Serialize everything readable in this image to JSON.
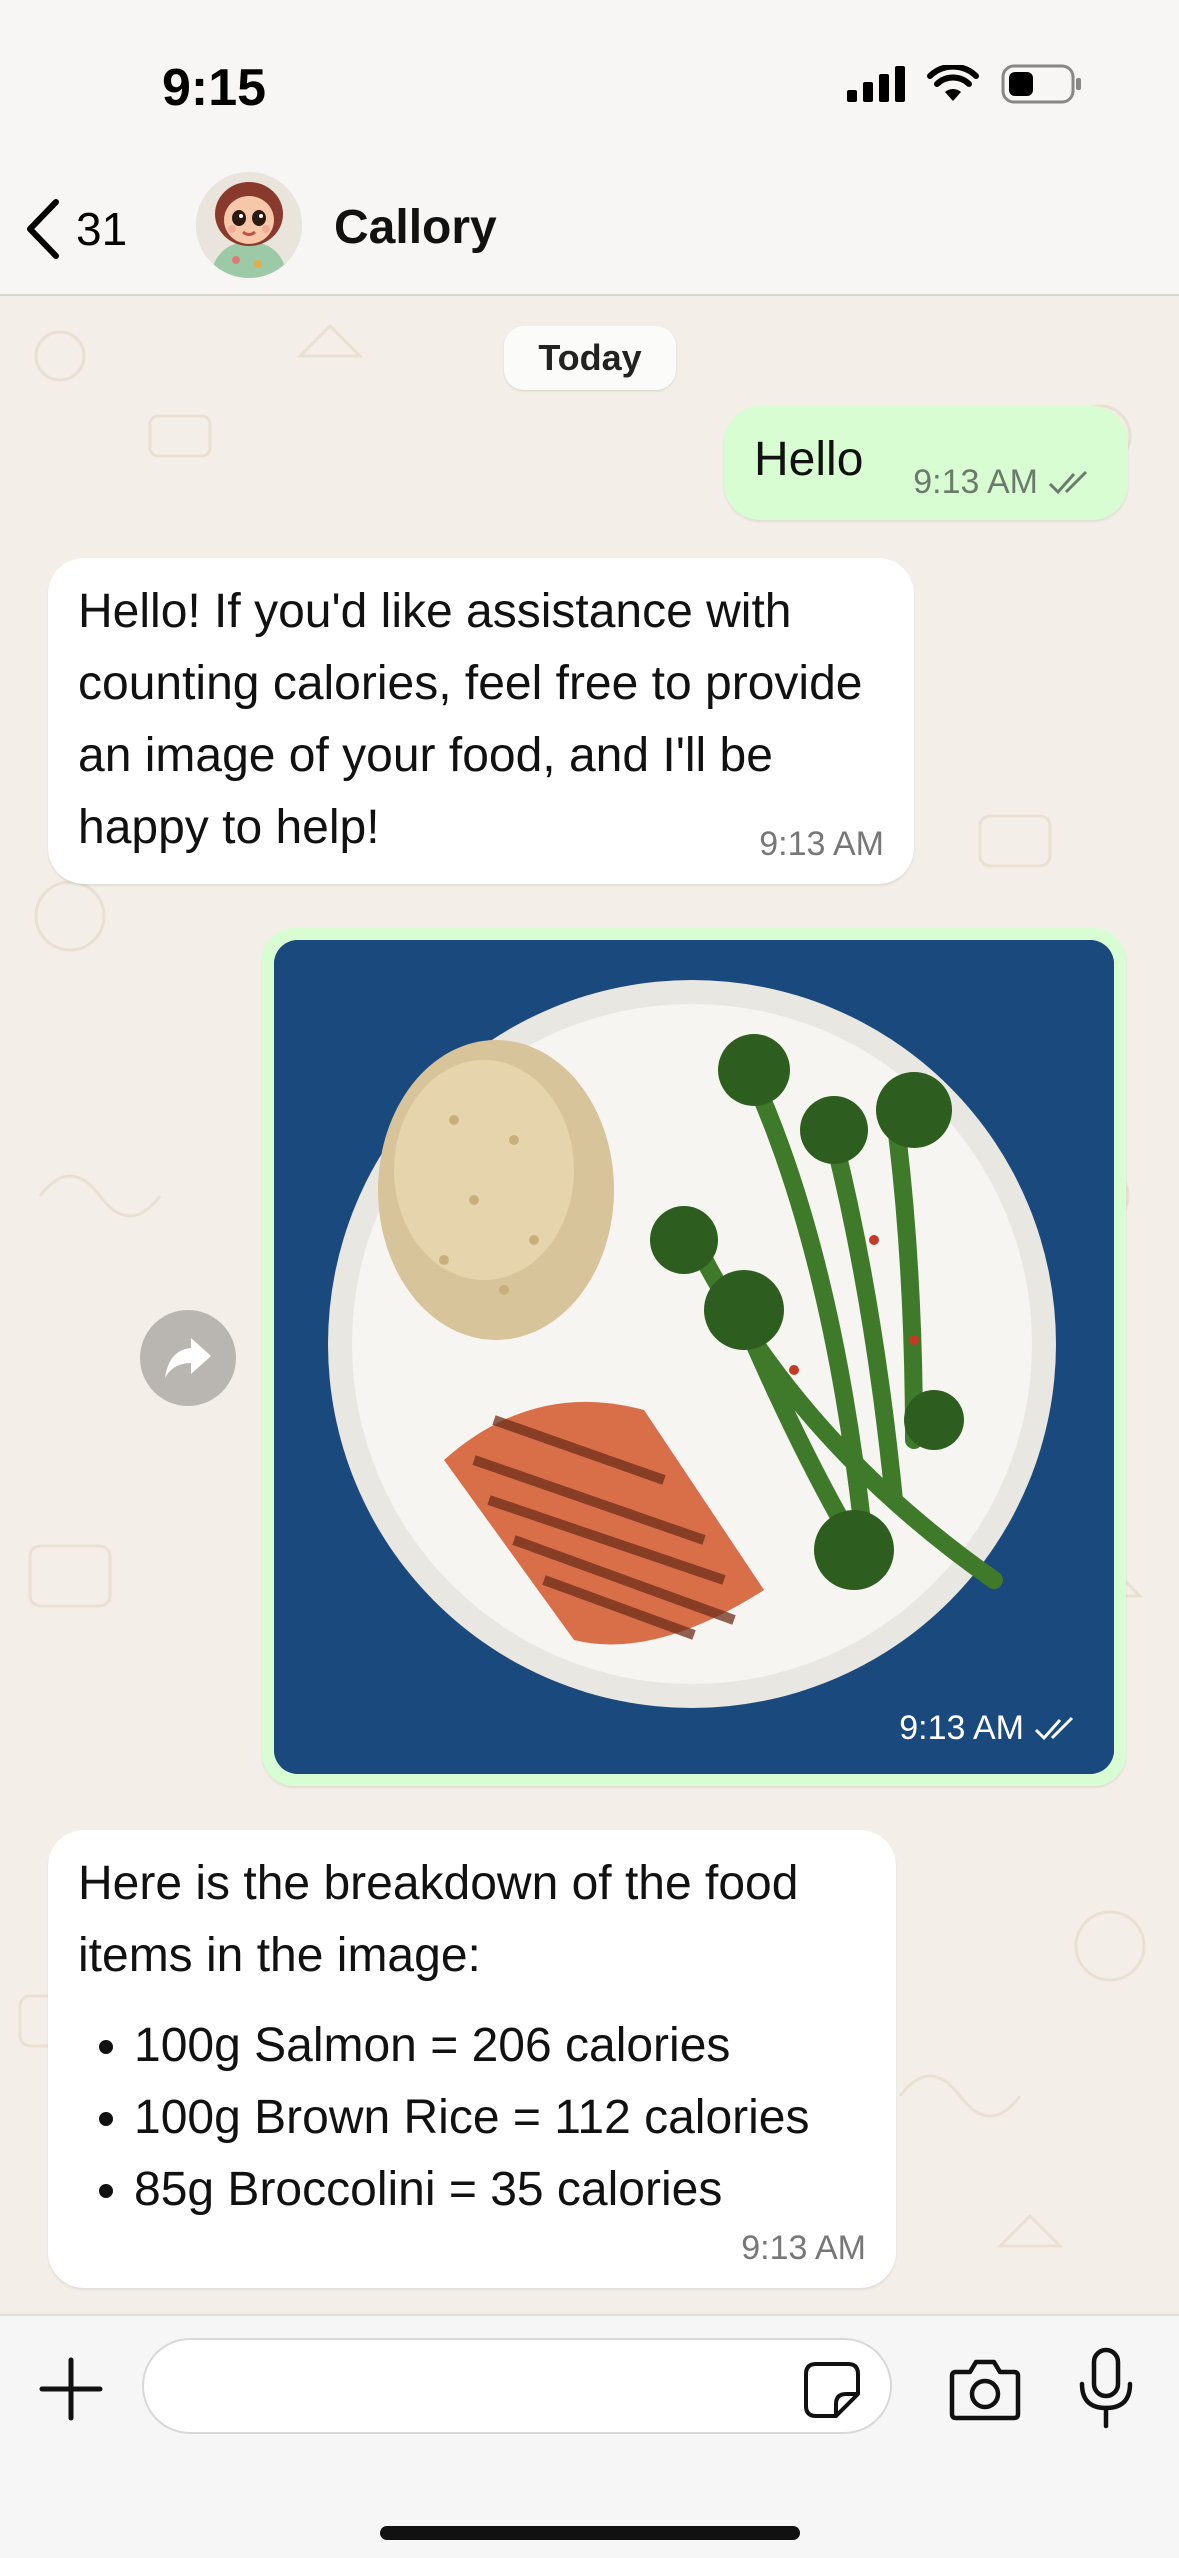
{
  "status_bar": {
    "time": "9:15"
  },
  "header": {
    "back_count": "31",
    "chat_name": "Callory"
  },
  "chat": {
    "date_chip": "Today",
    "messages": [
      {
        "direction": "out",
        "text": "Hello",
        "time": "9:13 AM"
      },
      {
        "direction": "in",
        "text": "Hello! If you'd like assistance with counting calories, feel free to provide an image of your food, and I'll be happy to help!",
        "time": "9:13 AM"
      },
      {
        "direction": "out",
        "type": "photo",
        "time": "9:13 AM"
      },
      {
        "direction": "in",
        "text": "Here is the breakdown of the food items in the image:",
        "items": [
          "100g Salmon = 206 calories",
          "100g Brown Rice = 112 calories",
          "85g Broccolini = 35 calories"
        ],
        "time": "9:13 AM"
      }
    ]
  },
  "composer": {
    "placeholder": ""
  },
  "colors": {
    "outgoing_bubble": "#d9fdd3",
    "incoming_bubble": "#ffffff",
    "chat_background": "#f3efe8",
    "photo_background": "#1d4f86"
  }
}
